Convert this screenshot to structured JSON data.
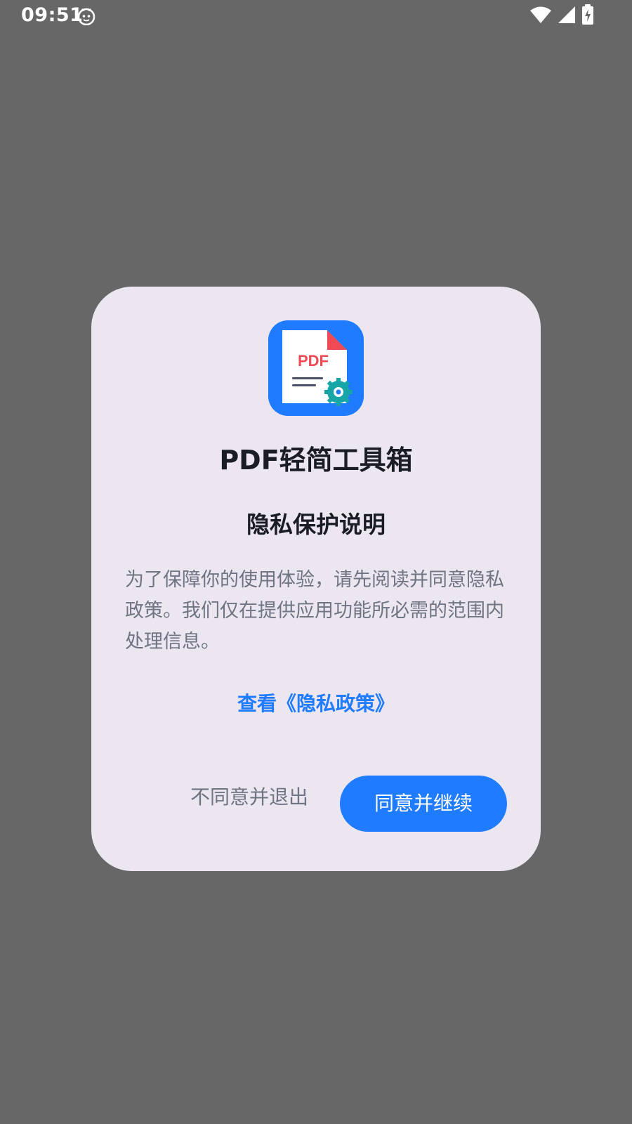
{
  "status_bar": {
    "time": "09:51",
    "app_icon": "cat-face-icon",
    "icons": [
      "wifi-icon",
      "signal-icon",
      "battery-charging-icon"
    ]
  },
  "dialog": {
    "app_name": "PDF轻简工具箱",
    "logo_text": "PDF",
    "title": "隐私保护说明",
    "body": "为了保障你的使用体验，请先阅读并同意隐私政策。我们仅在提供应用功能所必需的范围内处理信息。",
    "policy_link": "查看《隐私政策》",
    "decline_label": "不同意并退出",
    "accept_label": "同意并继续"
  },
  "colors": {
    "backdrop": "#676767",
    "dialog_bg": "#ebe6f0",
    "accent": "#1f7bff",
    "title_text": "#1b1d26",
    "secondary_text": "#6f7483",
    "pdf_red": "#f04b55",
    "gear_teal": "#17a5a5"
  }
}
